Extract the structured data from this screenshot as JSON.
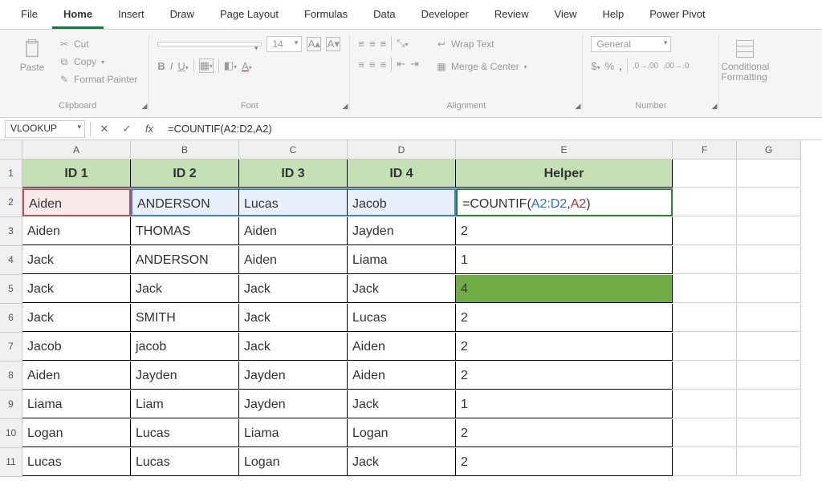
{
  "tabs": [
    "File",
    "Home",
    "Insert",
    "Draw",
    "Page Layout",
    "Formulas",
    "Data",
    "Developer",
    "Review",
    "View",
    "Help",
    "Power Pivot"
  ],
  "active_tab": "Home",
  "ribbon": {
    "clipboard": {
      "paste": "Paste",
      "cut": "Cut",
      "copy": "Copy",
      "fp": "Format Painter",
      "label": "Clipboard"
    },
    "font": {
      "name": "",
      "size": "14",
      "label": "Font"
    },
    "align": {
      "wrap": "Wrap Text",
      "merge": "Merge & Center",
      "label": "Alignment"
    },
    "number": {
      "fmt": "General",
      "label": "Number"
    },
    "cond": "Conditional\nFormatting"
  },
  "formula_bar": {
    "name_box": "VLOOKUP",
    "formula": "=COUNTIF(A2:D2,A2)"
  },
  "columns": [
    "A",
    "B",
    "C",
    "D",
    "E",
    "F",
    "G"
  ],
  "headers": [
    "ID 1",
    "ID 2",
    "ID 3",
    "ID 4",
    "Helper"
  ],
  "rows": [
    {
      "n": 1
    },
    {
      "n": 2,
      "c": [
        "Aiden",
        "ANDERSON",
        "Lucas",
        "Jacob",
        "=COUNTIF(A2:D2,A2)"
      ]
    },
    {
      "n": 3,
      "c": [
        "Aiden",
        "THOMAS",
        "Aiden",
        "Jayden",
        "2"
      ]
    },
    {
      "n": 4,
      "c": [
        "Jack",
        "ANDERSON",
        "Aiden",
        "Liama",
        "1"
      ]
    },
    {
      "n": 5,
      "c": [
        "Jack",
        "Jack",
        "Jack",
        "Jack",
        "4"
      ]
    },
    {
      "n": 6,
      "c": [
        "Jack",
        "SMITH",
        "Jack",
        "Lucas",
        "2"
      ]
    },
    {
      "n": 7,
      "c": [
        "Jacob",
        "jacob",
        "Jack",
        "Aiden",
        "2"
      ]
    },
    {
      "n": 8,
      "c": [
        "Aiden",
        "Jayden",
        "Jayden",
        "Aiden",
        "2"
      ]
    },
    {
      "n": 9,
      "c": [
        "Liama",
        "Liam",
        "Jayden",
        "Jack",
        "1"
      ]
    },
    {
      "n": 10,
      "c": [
        "Logan",
        "Lucas",
        "Liama",
        "Logan",
        "2"
      ]
    },
    {
      "n": 11,
      "c": [
        "Lucas",
        "Lucas",
        "Logan",
        "Jack",
        "2"
      ]
    }
  ],
  "formula_parts": {
    "prefix": "=COUNTIF(",
    "range": "A2:D2",
    "sep": ",",
    "crit": "A2",
    "suffix": ")"
  }
}
